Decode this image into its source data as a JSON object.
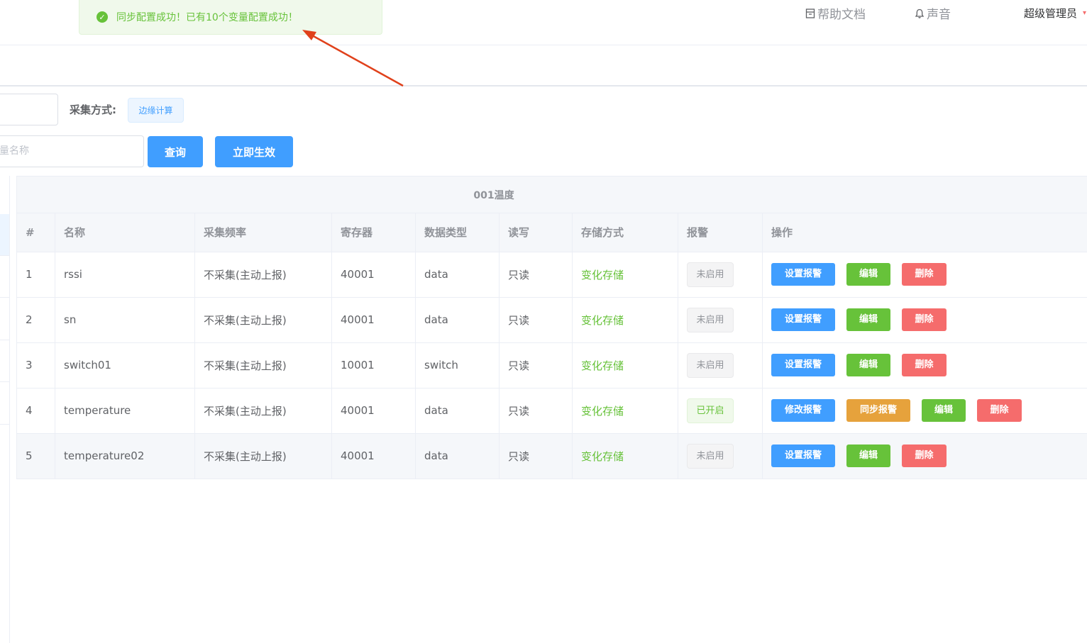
{
  "header": {
    "help_label": "帮助文档",
    "sound_label": "声音",
    "user_label": "超级管理员"
  },
  "toast": {
    "message": "同步配置成功！已有10个变量配置成功！"
  },
  "filters": {
    "collect_mode_label": "采集方式:",
    "collect_mode_tag": "边缘计算",
    "search_placeholder": "量名称",
    "query_button": "查询",
    "apply_button": "立即生效"
  },
  "table": {
    "title": "001温度",
    "columns": [
      "#",
      "名称",
      "采集频率",
      "寄存器",
      "数据类型",
      "读写",
      "存储方式",
      "报警",
      "操作"
    ],
    "rows": [
      {
        "idx": "1",
        "name": "rssi",
        "freq": "不采集(主动上报)",
        "reg": "40001",
        "type": "data",
        "rw": "只读",
        "store": "变化存储",
        "alarm": "未启用",
        "alarm_on": false,
        "ops": [
          "设置报警",
          "编辑",
          "删除"
        ]
      },
      {
        "idx": "2",
        "name": "sn",
        "freq": "不采集(主动上报)",
        "reg": "40001",
        "type": "data",
        "rw": "只读",
        "store": "变化存储",
        "alarm": "未启用",
        "alarm_on": false,
        "ops": [
          "设置报警",
          "编辑",
          "删除"
        ]
      },
      {
        "idx": "3",
        "name": "switch01",
        "freq": "不采集(主动上报)",
        "reg": "10001",
        "type": "switch",
        "rw": "只读",
        "store": "变化存储",
        "alarm": "未启用",
        "alarm_on": false,
        "ops": [
          "设置报警",
          "编辑",
          "删除"
        ]
      },
      {
        "idx": "4",
        "name": "temperature",
        "freq": "不采集(主动上报)",
        "reg": "40001",
        "type": "data",
        "rw": "只读",
        "store": "变化存储",
        "alarm": "已开启",
        "alarm_on": true,
        "ops": [
          "修改报警",
          "同步报警",
          "编辑",
          "删除"
        ]
      },
      {
        "idx": "5",
        "name": "temperature02",
        "freq": "不采集(主动上报)",
        "reg": "40001",
        "type": "data",
        "rw": "只读",
        "store": "变化存储",
        "alarm": "未启用",
        "alarm_on": false,
        "ops": [
          "设置报警",
          "编辑",
          "删除"
        ]
      }
    ]
  },
  "colors": {
    "primary": "#409eff",
    "success": "#67c23a",
    "danger": "#f56c6c",
    "warning": "#e6a23c",
    "annotation_arrow": "#e0411b"
  }
}
